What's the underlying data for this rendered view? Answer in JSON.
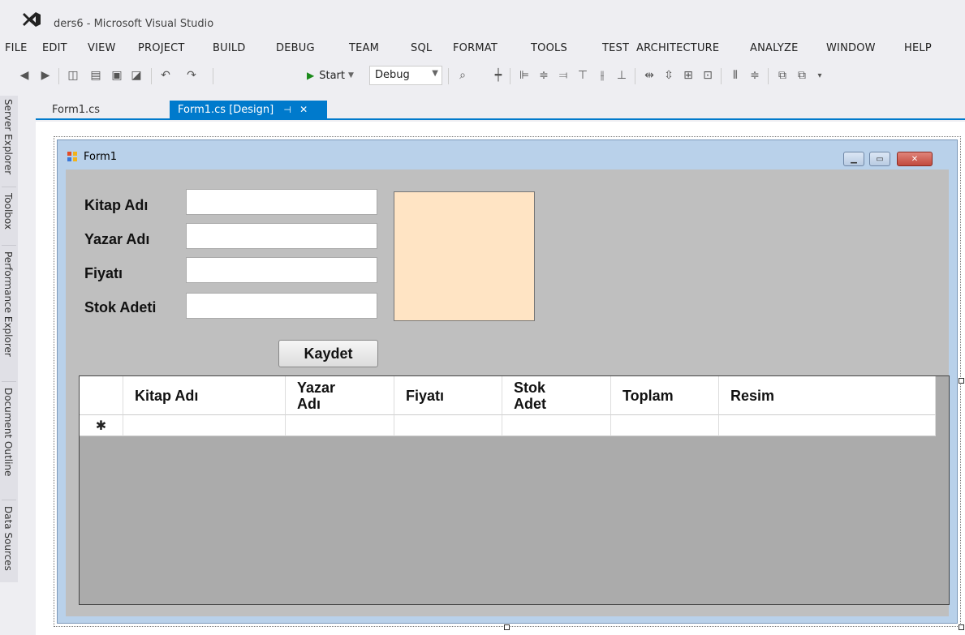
{
  "app": {
    "title": "ders6 - Microsoft Visual Studio"
  },
  "menu": [
    "FILE",
    "EDIT",
    "VIEW",
    "PROJECT",
    "BUILD",
    "DEBUG",
    "TEAM",
    "SQL",
    "FORMAT",
    "TOOLS",
    "TEST",
    "ARCHITECTURE",
    "ANALYZE",
    "WINDOW",
    "HELP"
  ],
  "toolbar": {
    "start_label": "Start",
    "config_value": "Debug"
  },
  "tabs": {
    "first": "Form1.cs",
    "active": "Form1.cs [Design]",
    "active_pin": "⊣",
    "active_close": "✕"
  },
  "side_panels": [
    "Server Explorer",
    "Toolbox",
    "Performance Explorer",
    "Document Outline",
    "Data Sources"
  ],
  "form": {
    "title": "Form1",
    "labels": {
      "kitap_adi": "Kitap Adı",
      "yazar_adi": "Yazar Adı",
      "fiyati": "Fiyatı",
      "stok_adeti": "Stok Adeti"
    },
    "inputs": {
      "kitap_adi": "",
      "yazar_adi": "",
      "fiyati": "",
      "stok_adeti": ""
    },
    "save_button": "Kaydet",
    "picture_color": "#ffe4c4"
  },
  "grid": {
    "columns": [
      "Kitap Adı",
      "Yazar Adı",
      "Fiyatı",
      "Stok Adet",
      "Toplam",
      "Resim"
    ],
    "new_row_marker": "✱"
  },
  "colors": {
    "accent": "#007acc",
    "form_client": "#bfbfbf",
    "grid_background": "#ababab"
  }
}
